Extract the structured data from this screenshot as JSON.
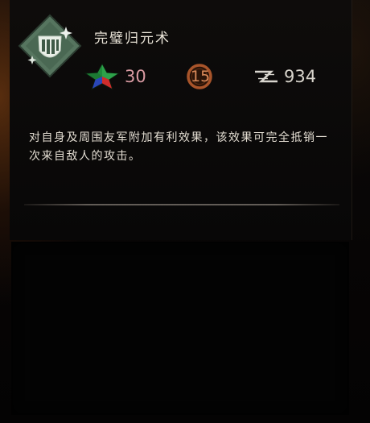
{
  "skill": {
    "title": "完璧归元术",
    "icon": "shield-bars-icon",
    "description": "对自身及周围友军附加有利效果，该效果可完全抵销一次来自敌人的攻击。"
  },
  "stats": {
    "star_value": "30",
    "ring_value": "15",
    "speed_value": "934"
  },
  "colors": {
    "icon_green": "#4f6e5a",
    "star_value": "#d99aa2",
    "ring_value": "#d98a5a",
    "text": "#e3ddd2"
  }
}
